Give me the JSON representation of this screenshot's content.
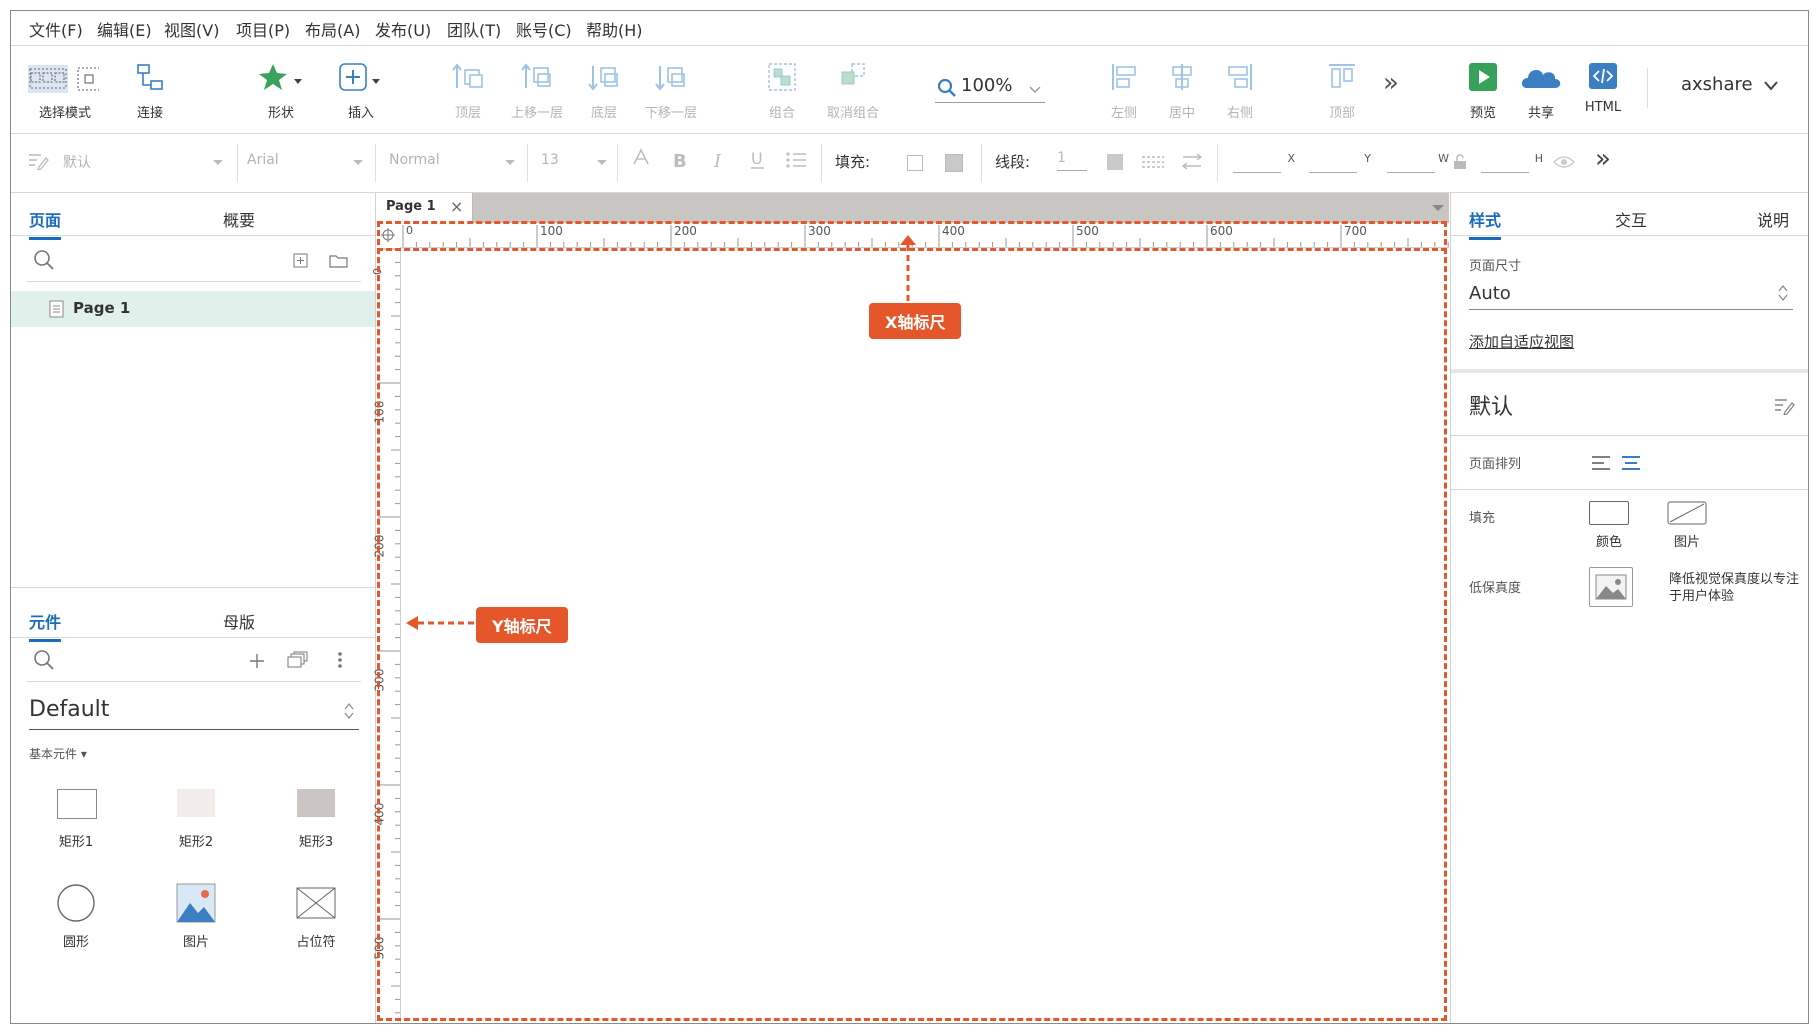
{
  "menubar": {
    "items": [
      "文件(F)",
      "编辑(E)",
      "视图(V)",
      "项目(P)",
      "布局(A)",
      "发布(U)",
      "团队(T)",
      "账号(C)",
      "帮助(H)"
    ]
  },
  "toolbar": {
    "select_mode": "选择模式",
    "connect": "连接",
    "shape": "形状",
    "insert": "插入",
    "to_top": "顶层",
    "forward": "上移一层",
    "to_bottom": "底层",
    "backward": "下移一层",
    "group": "组合",
    "ungroup": "取消组合",
    "zoom": "100%",
    "align_left": "左侧",
    "align_center": "居中",
    "align_right": "右侧",
    "align_top": "顶部",
    "more": "»",
    "preview": "预览",
    "share": "共享",
    "html": "HTML",
    "account": "axshare"
  },
  "format_bar": {
    "style": "默认",
    "font": "Arial",
    "weight": "Normal",
    "size": "13",
    "fill_label": "填充:",
    "line_label": "线段:",
    "line_value": "1",
    "x_label": "X",
    "y_label": "Y",
    "w_label": "W",
    "h_label": "H",
    "more": "»"
  },
  "left_panel": {
    "tabs": [
      "页面",
      "概要"
    ],
    "pages": [
      "Page 1"
    ],
    "lib_tabs": [
      "元件",
      "母版"
    ],
    "library": "Default",
    "category": "基本元件 ▾",
    "widgets": [
      "矩形1",
      "矩形2",
      "矩形3",
      "圆形",
      "图片",
      "占位符"
    ]
  },
  "canvas": {
    "tab_label": "Page 1",
    "tab_close": "×",
    "h_ticks": [
      "0",
      "100",
      "200",
      "300",
      "400",
      "500",
      "600",
      "700"
    ],
    "v_ticks": [
      "0",
      "100",
      "200",
      "300",
      "400",
      "500"
    ],
    "x_callout": "X轴标尺",
    "y_callout": "Y轴标尺",
    "accent_color": "#e5572a"
  },
  "right_panel": {
    "tabs": [
      "样式",
      "交互",
      "说明"
    ],
    "page_size_label": "页面尺寸",
    "page_size_value": "Auto",
    "adaptive_link": "添加自适应视图",
    "style_name": "默认",
    "page_align_label": "页面排列",
    "fill_label": "填充",
    "fill_color": "颜色",
    "fill_image": "图片",
    "low_fidelity_label": "低保真度",
    "low_fidelity_desc": "降低视觉保真度以专注于用户体验"
  }
}
